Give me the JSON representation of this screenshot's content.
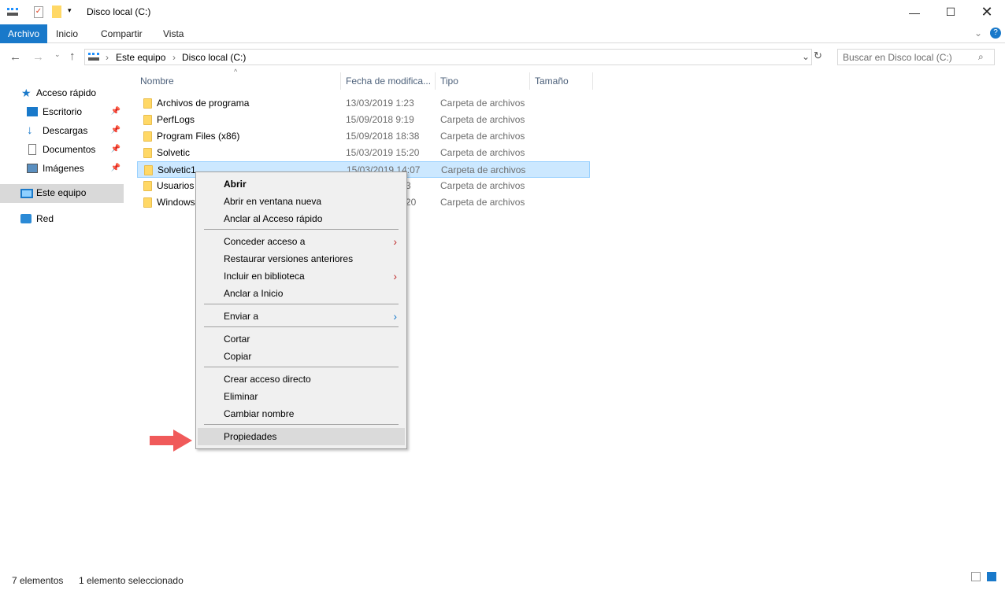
{
  "window": {
    "title": "Disco local (C:)"
  },
  "ribbon": {
    "tabs": [
      "Archivo",
      "Inicio",
      "Compartir",
      "Vista"
    ]
  },
  "nav": {
    "breadcrumb": [
      "Este equipo",
      "Disco local (C:)"
    ],
    "search_placeholder": "Buscar en Disco local (C:)"
  },
  "sidebar": {
    "items": [
      {
        "label": "Acceso rápido",
        "icon": "star-icon"
      },
      {
        "label": "Escritorio",
        "icon": "desktop-icon",
        "pinned": true
      },
      {
        "label": "Descargas",
        "icon": "download-icon",
        "pinned": true
      },
      {
        "label": "Documentos",
        "icon": "document-icon",
        "pinned": true
      },
      {
        "label": "Imágenes",
        "icon": "pictures-icon",
        "pinned": true
      },
      {
        "label": "Este equipo",
        "icon": "computer-icon"
      },
      {
        "label": "Red",
        "icon": "network-icon"
      }
    ]
  },
  "columns": [
    "Nombre",
    "Fecha de modifica...",
    "Tipo",
    "Tamaño"
  ],
  "files": [
    {
      "name": "Archivos de programa",
      "date": "13/03/2019 1:23",
      "type": "Carpeta de archivos"
    },
    {
      "name": "PerfLogs",
      "date": "15/09/2018 9:19",
      "type": "Carpeta de archivos"
    },
    {
      "name": "Program Files (x86)",
      "date": "15/09/2018 18:38",
      "type": "Carpeta de archivos"
    },
    {
      "name": "Solvetic",
      "date": "15/03/2019 15:20",
      "type": "Carpeta de archivos"
    },
    {
      "name": "Solvetic1",
      "date": "15/03/2019 14:07",
      "type": "Carpeta de archivos"
    },
    {
      "name": "Usuarios",
      "date": "3",
      "type": "Carpeta de archivos"
    },
    {
      "name": "Windows",
      "date": "20",
      "type": "Carpeta de archivos"
    }
  ],
  "context_menu": [
    "Abrir",
    "Abrir en ventana nueva",
    "Anclar al Acceso rápido",
    "Conceder acceso a",
    "Restaurar versiones anteriores",
    "Incluir en biblioteca",
    "Anclar a Inicio",
    "Enviar a",
    "Cortar",
    "Copiar",
    "Crear acceso directo",
    "Eliminar",
    "Cambiar nombre",
    "Propiedades"
  ],
  "status": {
    "count": "7 elementos",
    "selected": "1 elemento seleccionado"
  },
  "colors": {
    "accent": "#1979ca",
    "selection": "#cce8ff",
    "arrow": "#f05a5a"
  }
}
